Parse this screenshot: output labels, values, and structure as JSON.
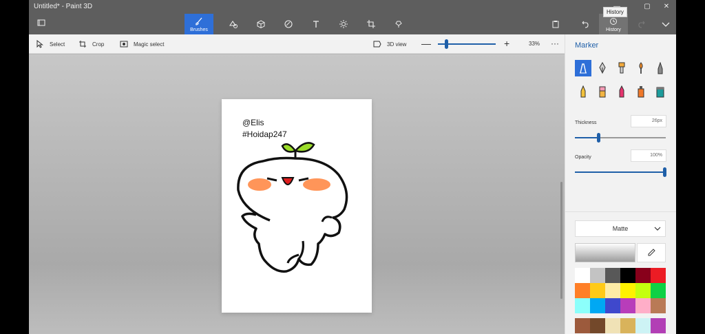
{
  "window": {
    "title": "Untitled* - Paint 3D",
    "controls": [
      "—",
      "▢",
      "✕"
    ]
  },
  "ribbon": {
    "brushes_label": "Brushes",
    "history_label": "History",
    "history_tooltip": "History"
  },
  "toolbar": {
    "select_label": "Select",
    "crop_label": "Crop",
    "magic_select_label": "Magic select",
    "view3d_label": "3D view",
    "zoom_minus": "—",
    "zoom_plus": "+",
    "zoom_level": "33%",
    "zoom_fraction": 0.15,
    "more_label": "···"
  },
  "canvas": {
    "text_line1": "@Elis",
    "text_line2": "#Hoidap247"
  },
  "panel": {
    "title": "Marker",
    "tools": [
      "marker",
      "calligraphy-pen",
      "oil-brush",
      "watercolor",
      "pencil-2d",
      "pencil",
      "eraser",
      "crayon",
      "spray-can",
      "fill-bucket"
    ],
    "thickness_label": "Thickness",
    "thickness_value": "26px",
    "thickness_fraction": 0.26,
    "opacity_label": "Opacity",
    "opacity_value": "100%",
    "opacity_fraction": 1.0,
    "finish_label": "Matte",
    "swatches": [
      "#ffffff",
      "#c3c3c3",
      "#585858",
      "#000000",
      "#88001b",
      "#ec1c24",
      "#ff7f27",
      "#ffca18",
      "#fdeca6",
      "#fff200",
      "#c4ff0e",
      "#0ed145",
      "#8cfffb",
      "#00a8f3",
      "#3f48cc",
      "#b83dba",
      "#ffaec8",
      "#b97a56"
    ],
    "swatches_row2": [
      "#9c5a3c",
      "#73482a",
      "#f0e2b6",
      "#d9b35b",
      "#cdf3f5",
      "#b23fb5"
    ]
  },
  "colors": {
    "accent": "#2e6fd8",
    "highlight": "#1f5fa8",
    "blush": "#ff7a2f",
    "sprout": "#9bdc29",
    "mouth": "#e01e1e"
  }
}
